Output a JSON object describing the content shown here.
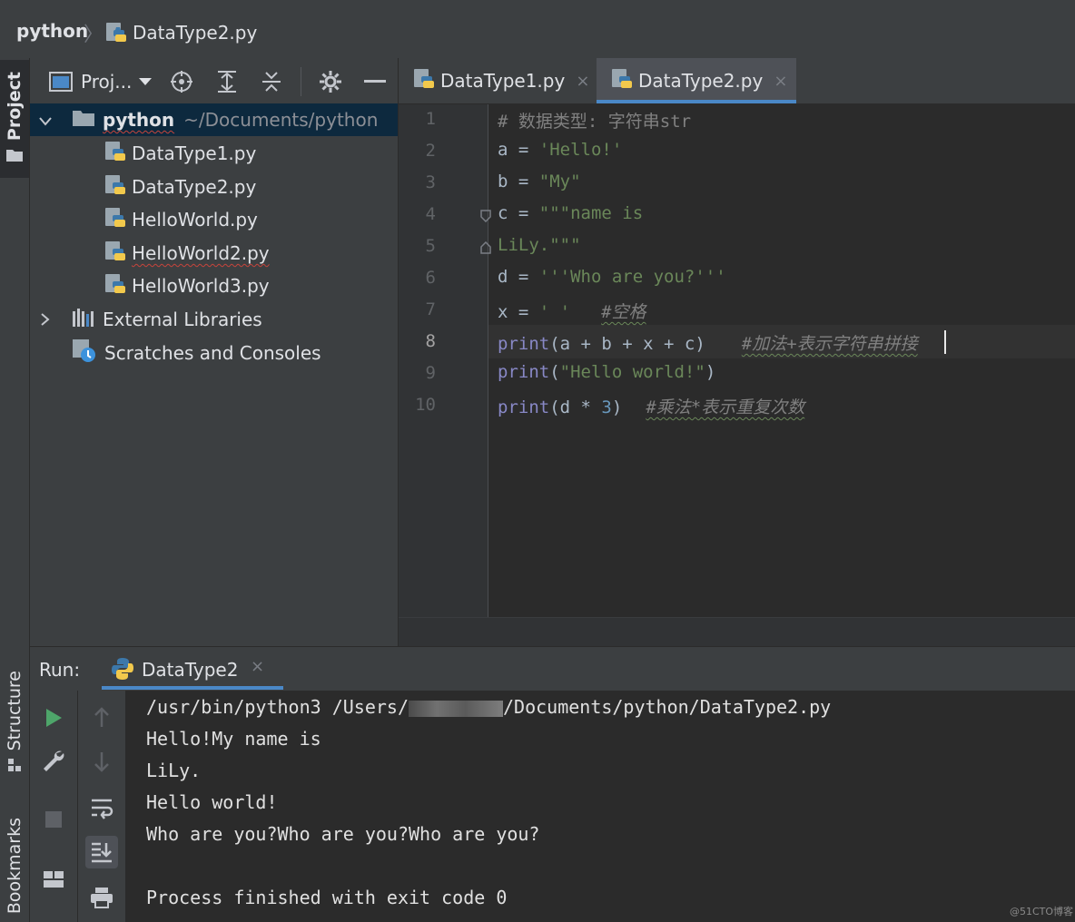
{
  "breadcrumb": {
    "root": "python",
    "separator": "〉",
    "file": "DataType2.py"
  },
  "side_tabs": {
    "project": "Project",
    "structure": "Structure",
    "bookmarks": "Bookmarks"
  },
  "project_panel": {
    "dropdown_label": "Proj...",
    "tree": {
      "root_name": "python",
      "root_path": "~/Documents/python",
      "files": [
        "DataType1.py",
        "DataType2.py",
        "HelloWorld.py",
        "HelloWorld2.py",
        "HelloWorld3.py"
      ],
      "external_libraries": "External Libraries",
      "scratches": "Scratches and Consoles"
    }
  },
  "editor_tabs": [
    {
      "label": "DataType1.py",
      "close": "×"
    },
    {
      "label": "DataType2.py",
      "close": "×"
    }
  ],
  "editor": {
    "line_numbers": [
      "1",
      "2",
      "3",
      "4",
      "5",
      "6",
      "7",
      "8",
      "9",
      "10"
    ],
    "current_line": "8",
    "lines": {
      "l1": "# 数据类型: 字符串str",
      "l2_var": "a",
      "l2_op": " = ",
      "l2_str": "'Hello!'",
      "l3_var": "b",
      "l3_op": " = ",
      "l3_str": "\"My\"",
      "l4_var": "c",
      "l4_op": " = ",
      "l4_str": "\"\"\"name is",
      "l5_str": "LiLy.\"\"\"",
      "l6_var": "d",
      "l6_op": " = ",
      "l6_str": "'''Who are you?'''",
      "l7_var": "x",
      "l7_op": " = ",
      "l7_str": "' '",
      "l7_com": "#空格",
      "l8_fn": "print",
      "l8_args": "(a + b + x + c)",
      "l8_com": "#加法+表示字符串拼接",
      "l9_fn": "print",
      "l9_open": "(",
      "l9_str": "\"Hello world!\"",
      "l9_close": ")",
      "l10_fn": "print",
      "l10_args_a": "(d * ",
      "l10_num": "3",
      "l10_args_b": ")",
      "l10_com": "#乘法*表示重复次数"
    }
  },
  "run_panel": {
    "label": "Run:",
    "tab_label": "DataType2",
    "tab_close": "×",
    "output": {
      "cmd_prefix": "/usr/bin/python3 /Users/",
      "cmd_suffix": "/Documents/python/DataType2.py",
      "lines": [
        "Hello!My name is",
        "LiLy.",
        "Hello world!",
        "Who are you?Who are you?Who are you?",
        "",
        "Process finished with exit code 0"
      ]
    }
  },
  "watermark": "@51CTO博客",
  "colors": {
    "accent": "#4a88c7",
    "string": "#6a8759",
    "builtin": "#8888c6",
    "number": "#6897bb",
    "comment": "#808080"
  }
}
